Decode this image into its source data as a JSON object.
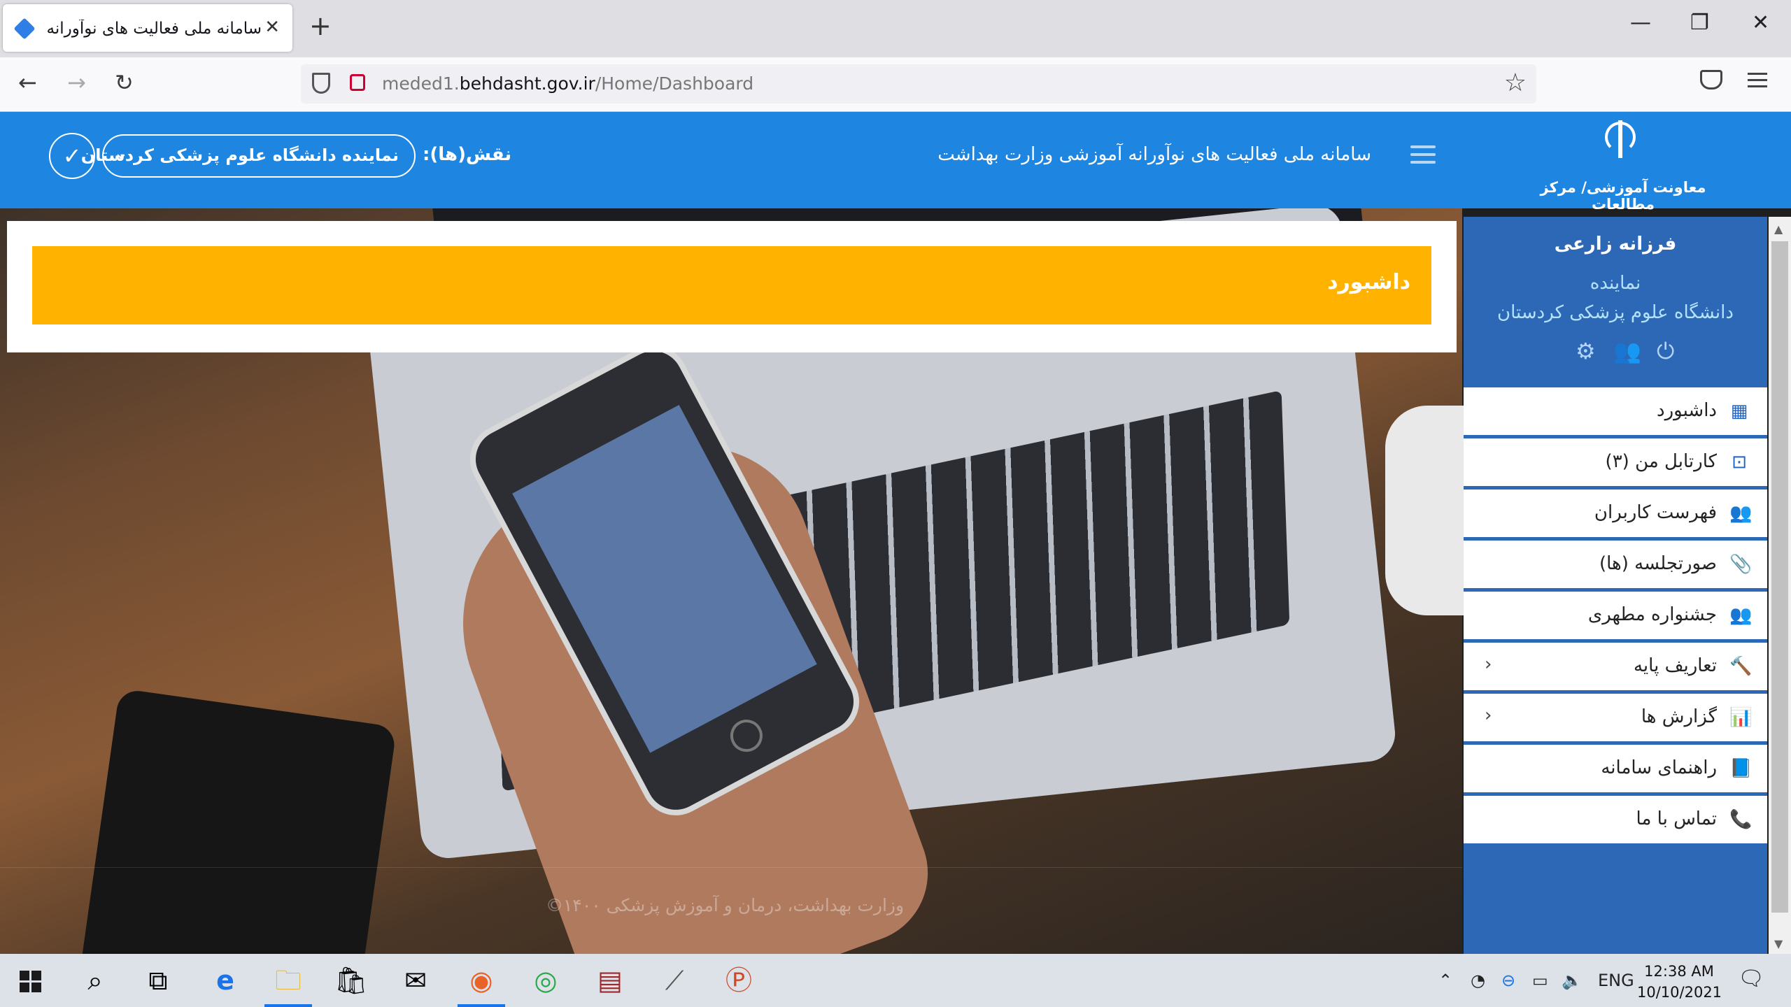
{
  "browser": {
    "tab_title": "سامانه ملی فعالیت های نوآورانه آموزشی",
    "new_tab": "+",
    "url_domain": "meded1.behdasht.gov.ir",
    "url_prefix": "meded1.",
    "url_host": "behdasht.gov.ir",
    "url_path": "/Home/Dashboard"
  },
  "header": {
    "logo_caption": "معاونت آموزشی/ مرکز مطالعات",
    "system_title": "سامانه ملی فعالیت های نوآورانه آموزشی وزارت بهداشت",
    "roles_label": "نقش(ها):",
    "selected_role": "نماینده دانشگاه علوم پزشکی کردستان"
  },
  "dashboard": {
    "banner_title": "داشبورد"
  },
  "footer": {
    "text": "وزارت بهداشت، درمان و آموزش پزشکی ۱۴۰۰©"
  },
  "sidebar": {
    "user_name": "فرزانه زارعی",
    "user_role": "نماینده",
    "user_university": "دانشگاه علوم پزشکی کردستان",
    "menu": [
      {
        "label": "داشبورد",
        "icon": "dashboard-icon",
        "glyph": "▦"
      },
      {
        "label": "کارتابل من (۳)",
        "icon": "inbox-icon",
        "glyph": "⊡"
      },
      {
        "label": "فهرست کاربران",
        "icon": "users-icon",
        "glyph": "👥"
      },
      {
        "label": "صورتجلسه (ها)",
        "icon": "paperclip-icon",
        "glyph": "📎"
      },
      {
        "label": "جشنواره مطهری",
        "icon": "users-icon",
        "glyph": "👥"
      },
      {
        "label": "تعاریف پایه",
        "icon": "wrench-icon",
        "glyph": "🔨"
      },
      {
        "label": "گزارش ها",
        "icon": "bar-chart-icon",
        "glyph": "📊"
      },
      {
        "label": "راهنمای سامانه",
        "icon": "book-icon",
        "glyph": "📘"
      },
      {
        "label": "تماس با ما",
        "icon": "phone-icon",
        "glyph": "📞"
      }
    ]
  },
  "taskbar": {
    "language": "ENG",
    "time": "12:38 AM",
    "date": "10/10/2021"
  },
  "colors": {
    "header_blue": "#1e86e0",
    "sidebar_blue": "#2c68b5",
    "banner_amber": "#ffb300"
  }
}
